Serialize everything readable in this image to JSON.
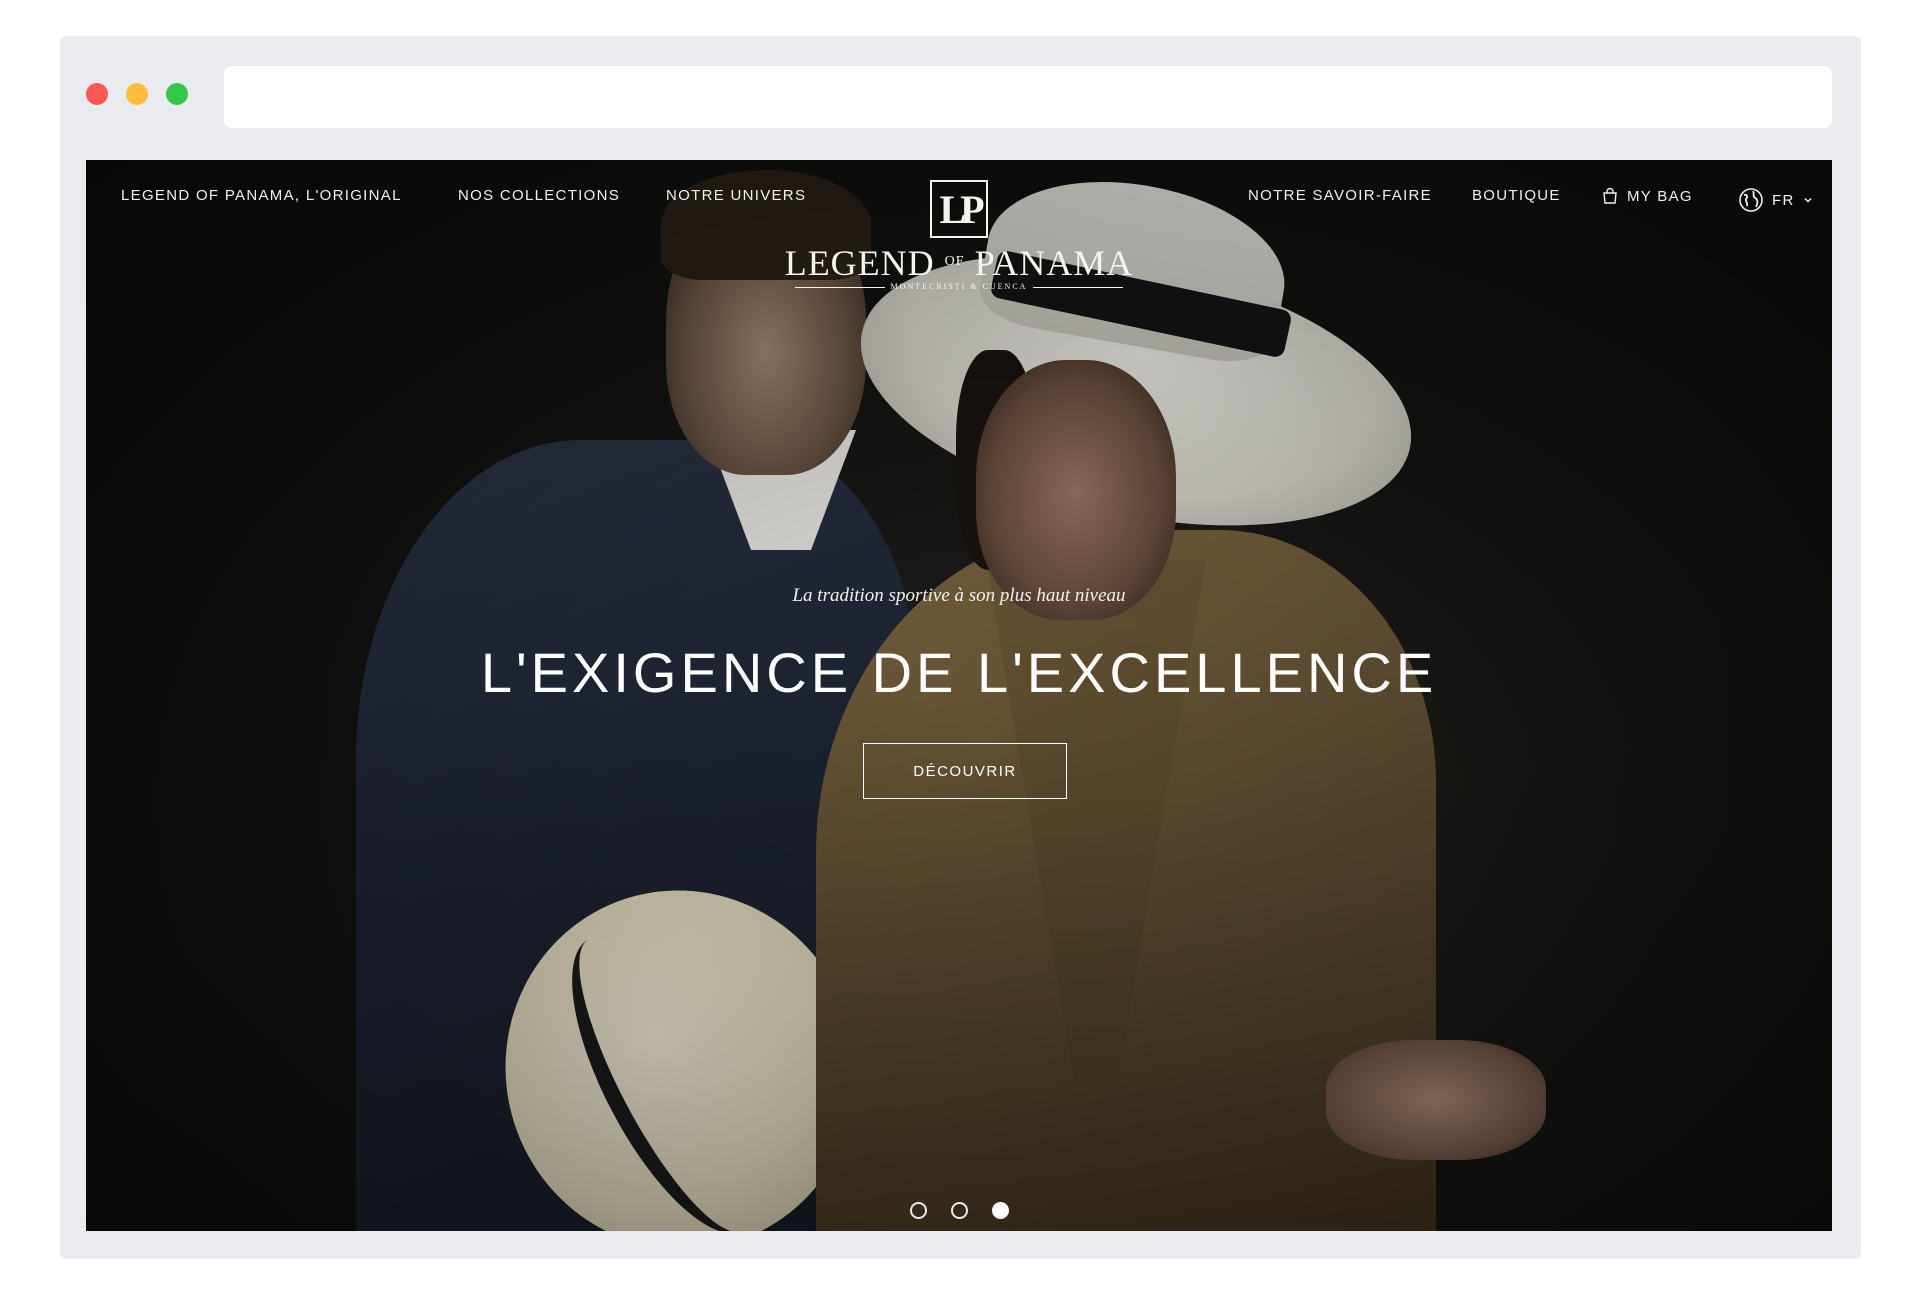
{
  "browser": {
    "dot_colors": [
      "#fc5753",
      "#fdbc40",
      "#34c84a"
    ],
    "address_value": ""
  },
  "nav": {
    "left": [
      "LEGEND OF PANAMA, L'ORIGINAL",
      "NOS COLLECTIONS",
      "NOTRE UNIVERS"
    ],
    "right": {
      "savoir_faire": "NOTRE SAVOIR-FAIRE",
      "boutique": "BOUTIQUE",
      "bag": "MY BAG",
      "lang": "FR"
    }
  },
  "logo": {
    "monogram": "LP",
    "name_left": "LEGEND",
    "name_of": "OF",
    "name_right": "PANAMA",
    "subtitle": "MONTECRISTI & CUENCA"
  },
  "hero": {
    "tagline": "La tradition sportive à son plus haut niveau",
    "headline": "L'EXIGENCE DE L'EXCELLENCE",
    "cta_label": "DÉCOUVRIR"
  },
  "carousel": {
    "slide_count": 3,
    "active_index": 2
  },
  "icons": {
    "bag": "shopping-bag-icon",
    "globe": "globe-icon",
    "chevron": "chevron-down-icon"
  }
}
